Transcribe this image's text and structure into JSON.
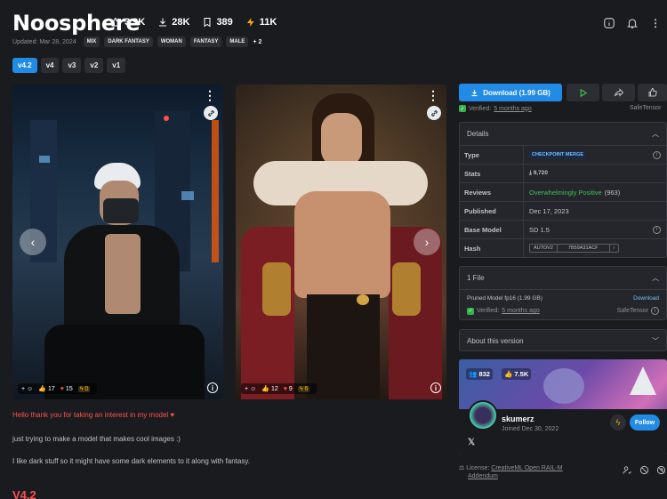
{
  "model": {
    "title": "Noosphere",
    "stats": {
      "likes": "3.9K",
      "downloads": "28K",
      "collected": "389",
      "buzz": "11K"
    },
    "updated": "Updated: Mar 28, 2024",
    "tags": [
      "MIX",
      "DARK FANTASY",
      "WOMAN",
      "FANTASY",
      "MALE"
    ],
    "more_tags": "+ 2"
  },
  "versions": [
    "v4.2",
    "v4",
    "v3",
    "v2",
    "v1"
  ],
  "gallery": [
    {
      "likes": "17",
      "hearts": "15",
      "buzz": "0"
    },
    {
      "likes": "12",
      "hearts": "9",
      "buzz": "6"
    }
  ],
  "description": {
    "line1": "Hello thank you for taking an interest in my model ♥",
    "line2": "just trying to make a model that makes cool images :)",
    "line3": "I like dark stuff so it might have some dark elements to it along with fantasy.",
    "version_heading": "V4.2"
  },
  "sidebar": {
    "download_label": "Download (1.99 GB)",
    "verified_prefix": "Verified:",
    "verified_time": "5 months ago",
    "safetensor": "SafeTensor",
    "details_title": "Details",
    "details": {
      "type_label": "Type",
      "type_value": "CHECKPOINT MERGE",
      "stats_label": "Stats",
      "stats_value": "9,720",
      "reviews_label": "Reviews",
      "reviews_value": "Overwhelmingly Positive",
      "reviews_count": "(963)",
      "published_label": "Published",
      "published_value": "Dec 17, 2023",
      "base_label": "Base Model",
      "base_value": "SD 1.5",
      "hash_label": "Hash",
      "hash_algo": "AUTOV2",
      "hash_value": "7B59A31ACF"
    },
    "files_title": "1 File",
    "file_name": "Pruned Model fp16 (1.99 GB)",
    "file_download": "Download",
    "file_verified_time": "5 months ago",
    "about_title": "About this version",
    "creator": {
      "uploads": "832",
      "likes": "7.5K",
      "name": "skumerz",
      "joined": "Joined Dec 30, 2022",
      "follow": "Follow"
    },
    "license_prefix": "License:",
    "license_link": "CreativeML Open RAIL-M",
    "license_link2": "Addendum"
  },
  "colors": {
    "accent": "#228be6",
    "danger": "#fa5252",
    "success": "#40c057"
  }
}
